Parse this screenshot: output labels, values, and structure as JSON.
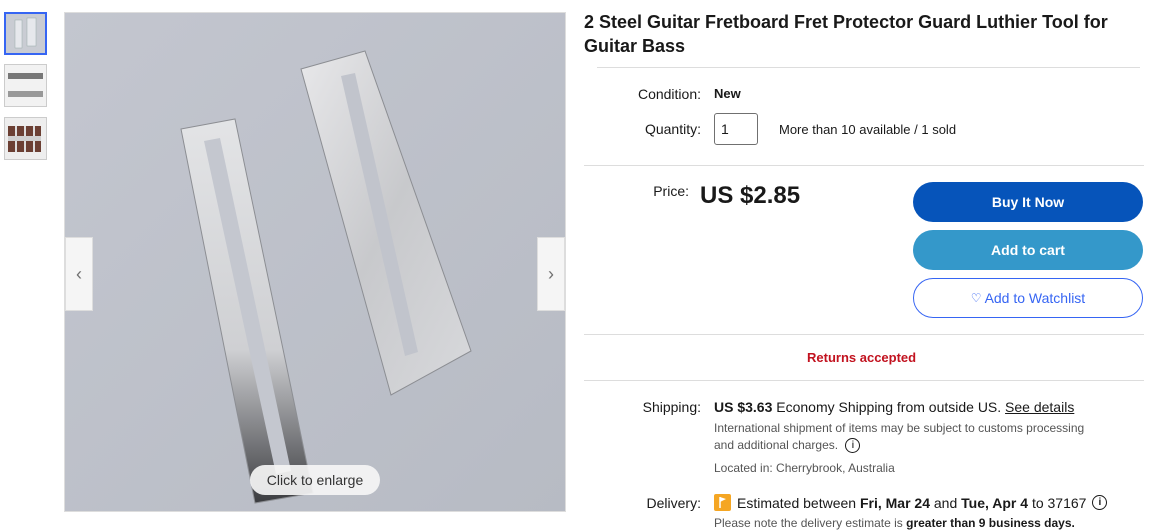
{
  "item": {
    "title": "2 Steel Guitar Fretboard Fret Protector Guard Luthier Tool for Guitar Bass"
  },
  "gallery": {
    "enlarge_label": "Click to enlarge",
    "prev_icon": "chevron-left-icon",
    "next_icon": "chevron-right-icon"
  },
  "condition": {
    "label": "Condition:",
    "value": "New"
  },
  "quantity": {
    "label": "Quantity:",
    "value": "1",
    "availability": "More than 10 available / 1 sold"
  },
  "price": {
    "label": "Price:",
    "value": "US $2.85"
  },
  "buttons": {
    "buy_now": "Buy It Now",
    "add_to_cart": "Add to cart",
    "watchlist": "Add to Watchlist"
  },
  "returns": "Returns accepted",
  "shipping": {
    "label": "Shipping:",
    "cost": "US $3.63",
    "method": "Economy Shipping from outside US.",
    "details_link": "See details",
    "note_line1": "International shipment of items may be subject to customs processing",
    "note_line2": "and additional charges.",
    "location": "Located in: Cherrybrook, Australia"
  },
  "delivery": {
    "label": "Delivery:",
    "prefix": "Estimated between",
    "start": "Fri, Mar 24",
    "and": "and",
    "end": "Tue, Apr 4",
    "to": "to 37167",
    "note_prefix": "Please note the delivery estimate is",
    "note_bold": "greater than 9 business days."
  },
  "colors": {
    "accent_blue": "#3665f3",
    "buy_now_bg": "#0654ba",
    "cart_bg": "#3498ca",
    "returns_red": "#c2121f",
    "delivery_flag": "#f5a623"
  }
}
